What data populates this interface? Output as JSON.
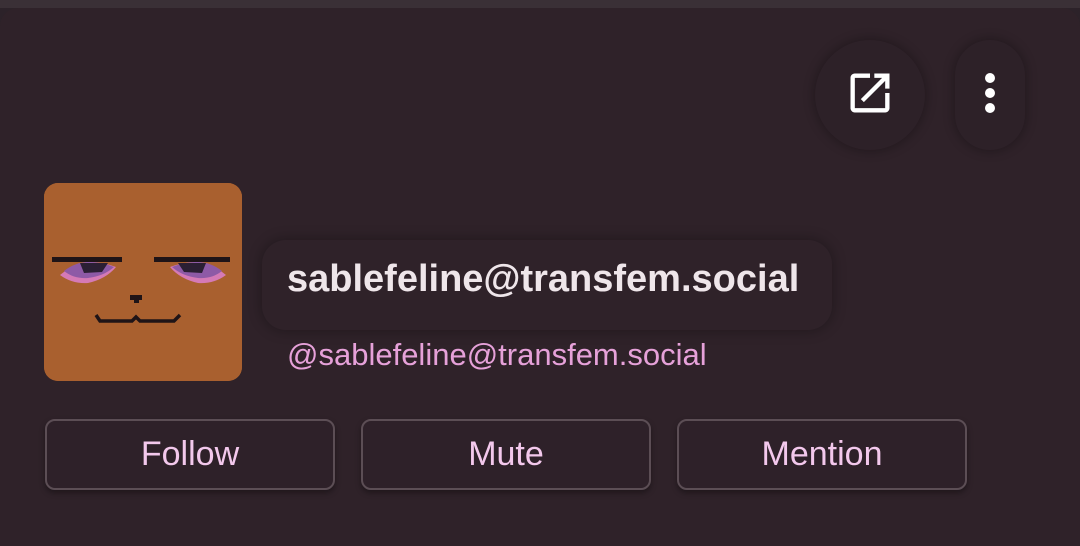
{
  "profile": {
    "display_name": "sablefeline@transfem.social",
    "handle": "@sablefeline@transfem.social",
    "avatar_icon": "cat-face-avatar"
  },
  "toolbar": {
    "open_icon": "open-external-icon",
    "more_icon": "more-vertical-icon"
  },
  "actions": {
    "follow_label": "Follow",
    "mute_label": "Mute",
    "mention_label": "Mention"
  },
  "colors": {
    "background": "#2f2229",
    "name_text": "#efe6ea",
    "handle_text": "#e6a1d9",
    "button_text": "#f3c8ec",
    "avatar_bg": "#a9602f"
  }
}
